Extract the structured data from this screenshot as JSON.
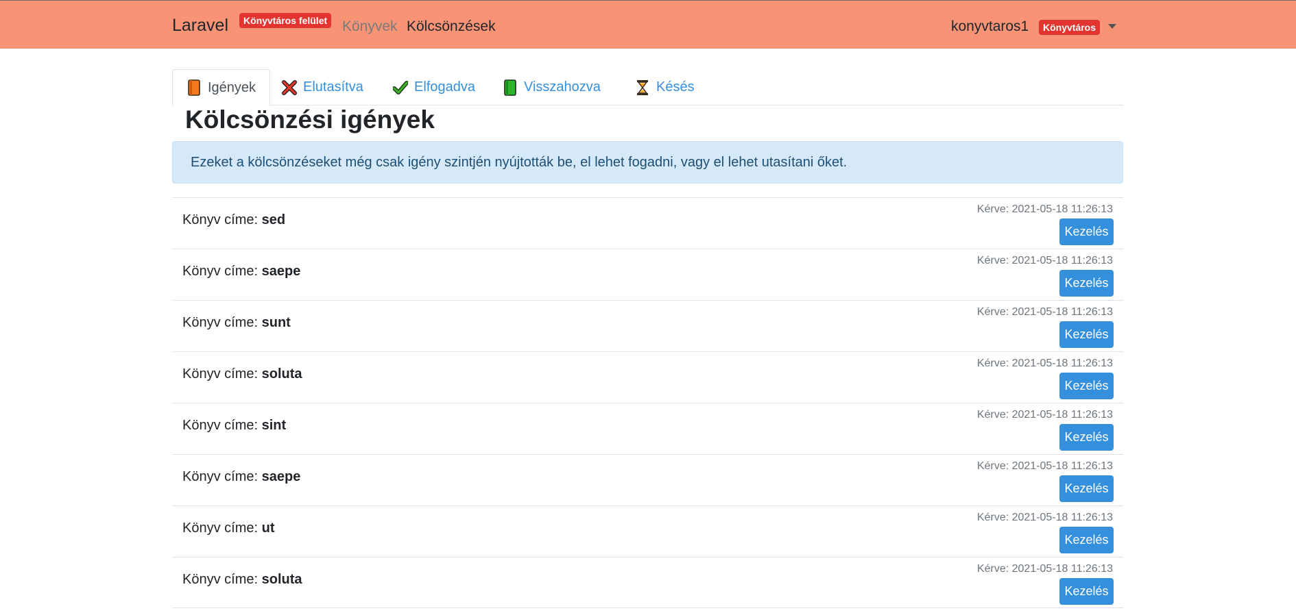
{
  "navbar": {
    "brand": "Laravel",
    "admin_badge": "Könyvtáros felület",
    "links": [
      "Könyvek",
      "Kölcsönzések"
    ],
    "username": "konyvtaros1",
    "role_badge": "Könyvtáros",
    "dropdown_icon": "caret-down-icon",
    "background_color": "#f89475"
  },
  "tabs": [
    {
      "label": "Igények",
      "icon": "orange-book-icon",
      "active": true
    },
    {
      "label": "Elutasítva",
      "icon": "red-cross-icon",
      "active": false
    },
    {
      "label": "Elfogadva",
      "icon": "green-check-icon",
      "active": false
    },
    {
      "label": "Visszahozva",
      "icon": "green-book-icon",
      "active": false
    },
    {
      "label": "Késés",
      "icon": "hourglass-icon",
      "active": false
    }
  ],
  "page": {
    "title": "Kölcsönzési igények",
    "alert": "Ezeket a kölcsönzéseket még csak igény szintjén nyújtották be, el lehet fogadni, vagy el lehet utasítani őket."
  },
  "requests": {
    "title_prefix": "Könyv címe:",
    "button_label": "Kezelés",
    "accent_color": "#3490dc",
    "items": [
      {
        "title": "sed",
        "date": "Kérve: 2021-05-18 11:26:13"
      },
      {
        "title": "saepe",
        "date": "Kérve: 2021-05-18 11:26:13"
      },
      {
        "title": "sunt",
        "date": "Kérve: 2021-05-18 11:26:13"
      },
      {
        "title": "soluta",
        "date": "Kérve: 2021-05-18 11:26:13"
      },
      {
        "title": "sint",
        "date": "Kérve: 2021-05-18 11:26:13"
      },
      {
        "title": "saepe",
        "date": "Kérve: 2021-05-18 11:26:13"
      },
      {
        "title": "ut",
        "date": "Kérve: 2021-05-18 11:26:13"
      },
      {
        "title": "soluta",
        "date": "Kérve: 2021-05-18 11:26:13"
      }
    ]
  }
}
